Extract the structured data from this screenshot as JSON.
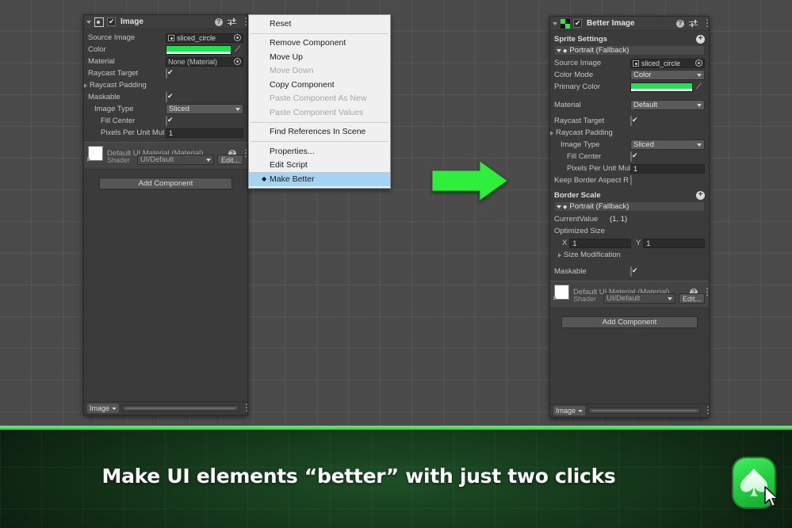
{
  "scene": {
    "arrow_color": "#30ee3c",
    "background_color": "#4b4b4b"
  },
  "left_inspector": {
    "header": {
      "title": "Image",
      "icon": "image-component-icon",
      "enabled": true,
      "help_icon": "help-icon",
      "preset_icon": "preset-icon",
      "menu_icon": "kebab-menu-icon"
    },
    "rows": [
      {
        "label": "Source Image",
        "type": "object",
        "value": "sliced_circle"
      },
      {
        "label": "Color",
        "type": "color",
        "value": "#19E64B"
      },
      {
        "label": "Material",
        "type": "object",
        "value": "None (Material)"
      },
      {
        "label": "Raycast Target",
        "type": "checkbox",
        "value": true
      },
      {
        "label": "Raycast Padding",
        "type": "foldout",
        "value": ""
      },
      {
        "label": "Maskable",
        "type": "checkbox",
        "value": true
      },
      {
        "label": "Image Type",
        "type": "popup",
        "value": "Sliced"
      },
      {
        "label": "Fill Center",
        "type": "checkbox",
        "value": true
      },
      {
        "label": "Pixels Per Unit Mul",
        "type": "text",
        "value": "1"
      }
    ],
    "material_block": {
      "title": "Default UI Material (Material)",
      "shader_label": "Shader",
      "shader_value": "UI/Default",
      "edit_label": "Edit...",
      "swatch_color": "#ffffff"
    },
    "add_component_label": "Add Component",
    "footer": {
      "tag": "Image"
    }
  },
  "context_menu": {
    "items": [
      {
        "label": "Reset",
        "state": "normal",
        "separator_after": true
      },
      {
        "label": "Remove Component",
        "state": "normal"
      },
      {
        "label": "Move Up",
        "state": "normal"
      },
      {
        "label": "Move Down",
        "state": "disabled"
      },
      {
        "label": "Copy Component",
        "state": "normal"
      },
      {
        "label": "Paste Component As New",
        "state": "disabled"
      },
      {
        "label": "Paste Component Values",
        "state": "disabled",
        "separator_after": true
      },
      {
        "label": "Find References In Scene",
        "state": "normal",
        "separator_after": true
      },
      {
        "label": "Properties...",
        "state": "normal"
      },
      {
        "label": "Edit Script",
        "state": "normal"
      },
      {
        "label": "Make Better",
        "state": "selected",
        "bullet": "◆"
      }
    ],
    "highlight_color": "#a5d4f2"
  },
  "right_inspector": {
    "header": {
      "title": "Better Image",
      "icon": "better-image-component-icon",
      "enabled": true,
      "help_icon": "help-icon",
      "preset_icon": "preset-icon",
      "menu_icon": "kebab-menu-icon"
    },
    "sprite_settings": {
      "section_title": "Sprite Settings",
      "add_label": "+",
      "variant": "Portrait (Fallback)",
      "rows": [
        {
          "label": "Source Image",
          "type": "object",
          "value": "sliced_circle"
        },
        {
          "label": "Color Mode",
          "type": "popup",
          "value": "Color"
        },
        {
          "label": "Primary Color",
          "type": "color",
          "value": "#19E64B"
        }
      ]
    },
    "rows": [
      {
        "label": "Material",
        "type": "popup",
        "value": "Default"
      },
      {
        "label": "Raycast Target",
        "type": "checkbox",
        "value": true
      },
      {
        "label": "Raycast Padding",
        "type": "foldout",
        "value": ""
      },
      {
        "label": "Image Type",
        "type": "popup",
        "value": "Sliced"
      },
      {
        "label": "Fill Center",
        "type": "checkbox",
        "value": true
      },
      {
        "label": "Pixels Per Unit Mul",
        "type": "text",
        "value": "1"
      },
      {
        "label": "Keep Border Aspect R",
        "type": "checkbox",
        "value": false
      }
    ],
    "border_scale": {
      "section_title": "Border Scale",
      "add_label": "+",
      "variant": "Portrait (Fallback)",
      "current_value_label": "CurrentValue",
      "current_value": "(1, 1)",
      "optimized_size_label": "Optimized Size",
      "x_label": "X",
      "x_value": "1",
      "y_label": "Y",
      "y_value": "1",
      "size_modification_label": "Size Modification"
    },
    "maskable": {
      "label": "Maskable",
      "value": true
    },
    "material_block": {
      "title": "Default UI Material (Material)",
      "shader_label": "Shader",
      "shader_value": "UI/Default",
      "edit_label": "Edit...",
      "swatch_color": "#ffffff"
    },
    "add_component_label": "Add Component",
    "footer": {
      "tag": "Image"
    }
  },
  "banner": {
    "tagline": "Make UI elements “better” with just two clicks",
    "accent_color": "#35ef47",
    "logo": {
      "name": "app-logo-spade",
      "glyph": "spade"
    }
  }
}
